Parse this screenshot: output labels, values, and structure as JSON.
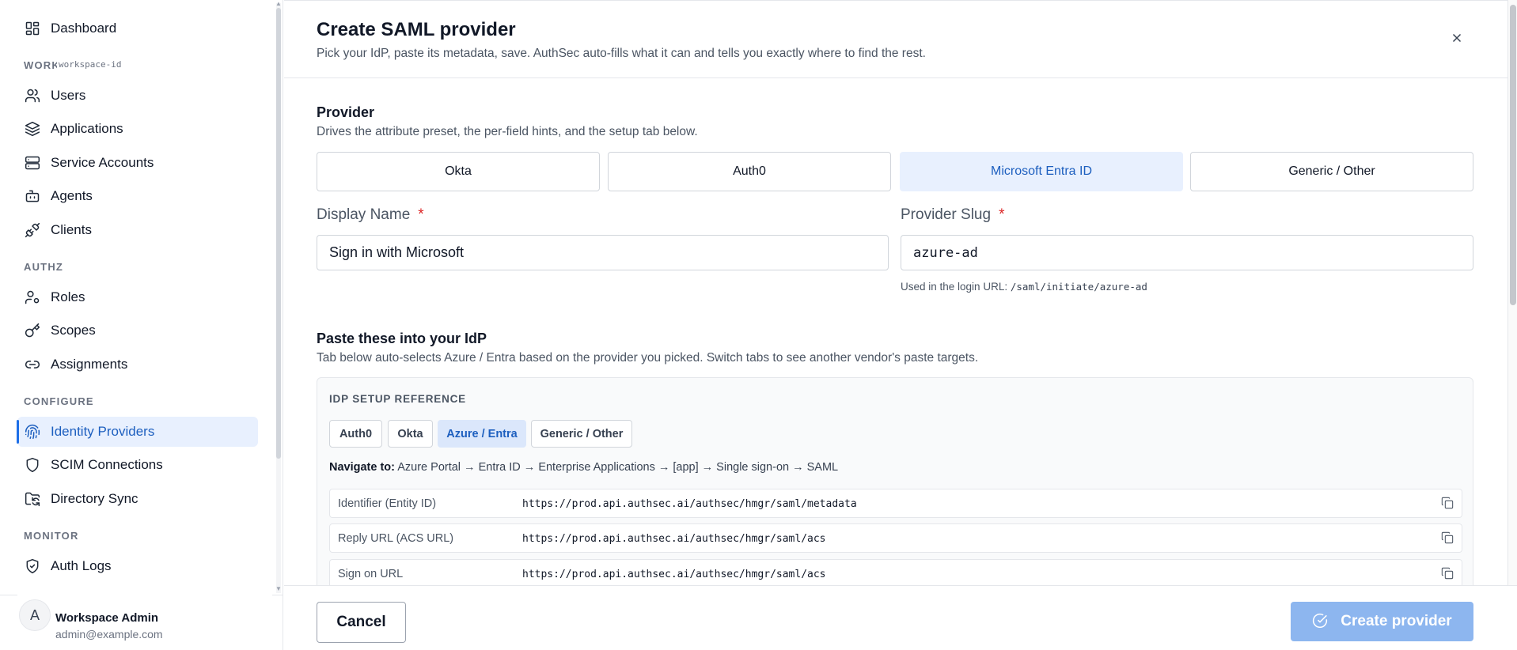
{
  "sidebar": {
    "top_item": {
      "label": "Dashboard",
      "icon": "dashboard-icon"
    },
    "workspace_label": "WORKSPACE",
    "workspace_id": "workspace-id",
    "workspace_items": [
      {
        "label": "Users",
        "icon": "users-icon"
      },
      {
        "label": "Applications",
        "icon": "layers-icon"
      },
      {
        "label": "Service Accounts",
        "icon": "server-icon"
      },
      {
        "label": "Agents",
        "icon": "bot-icon"
      },
      {
        "label": "Clients",
        "icon": "plug-icon"
      }
    ],
    "authz_label": "AUTHZ",
    "authz_items": [
      {
        "label": "Roles",
        "icon": "user-cog-icon"
      },
      {
        "label": "Scopes",
        "icon": "key-icon"
      },
      {
        "label": "Assignments",
        "icon": "link-icon"
      }
    ],
    "configure_label": "CONFIGURE",
    "configure_items": [
      {
        "label": "Identity Providers",
        "icon": "fingerprint-icon",
        "active": true
      },
      {
        "label": "SCIM Connections",
        "icon": "shield-icon"
      },
      {
        "label": "Directory Sync",
        "icon": "folder-sync-icon"
      }
    ],
    "monitor_label": "MONITOR",
    "monitor_items": [
      {
        "label": "Auth Logs",
        "icon": "shield-check-icon"
      }
    ],
    "user": {
      "initial": "A",
      "name": "Workspace Admin",
      "email": "admin@example.com"
    }
  },
  "dialog": {
    "title": "Create SAML provider",
    "subtitle": "Pick your IdP, paste its metadata, save. AuthSec auto-fills what it can and tells you exactly where to find the rest.",
    "provider": {
      "title": "Provider",
      "description": "Drives the attribute preset, the per-field hints, and the setup tab below.",
      "options": [
        "Okta",
        "Auth0",
        "Microsoft Entra ID",
        "Generic / Other"
      ],
      "selected": "Microsoft Entra ID"
    },
    "display_name": {
      "label": "Display Name",
      "required_mark": "*",
      "value": "Sign in with Microsoft"
    },
    "provider_slug": {
      "label": "Provider Slug",
      "required_mark": "*",
      "value": "azure-ad",
      "hint_prefix": "Used in the login URL:",
      "hint_path": "/saml/initiate/azure-ad"
    },
    "paste": {
      "title": "Paste these into your IdP",
      "description": "Tab below auto-selects Azure / Entra based on the provider you picked. Switch tabs to see another vendor's paste targets."
    },
    "reference": {
      "title": "IDP SETUP REFERENCE",
      "tabs": [
        "Auth0",
        "Okta",
        "Azure / Entra",
        "Generic / Other"
      ],
      "selected_tab": "Azure / Entra",
      "navigate_label": "Navigate to:",
      "navigate_path": "Azure Portal → Entra ID → Enterprise Applications → [app] → Single sign-on → SAML",
      "rows": [
        {
          "key": "Identifier (Entity ID)",
          "value": "https://prod.api.authsec.ai/authsec/hmgr/saml/metadata"
        },
        {
          "key": "Reply URL (ACS URL)",
          "value": "https://prod.api.authsec.ai/authsec/hmgr/saml/acs"
        },
        {
          "key": "Sign on URL",
          "value": "https://prod.api.authsec.ai/authsec/hmgr/saml/acs"
        }
      ]
    },
    "footer": {
      "cancel_label": "Cancel",
      "create_label": "Create provider"
    }
  },
  "colors": {
    "accent": "#1d6fe8",
    "active_bg": "#e8f0fe",
    "create_disabled": "#8db6ef",
    "required": "#dc2626"
  }
}
